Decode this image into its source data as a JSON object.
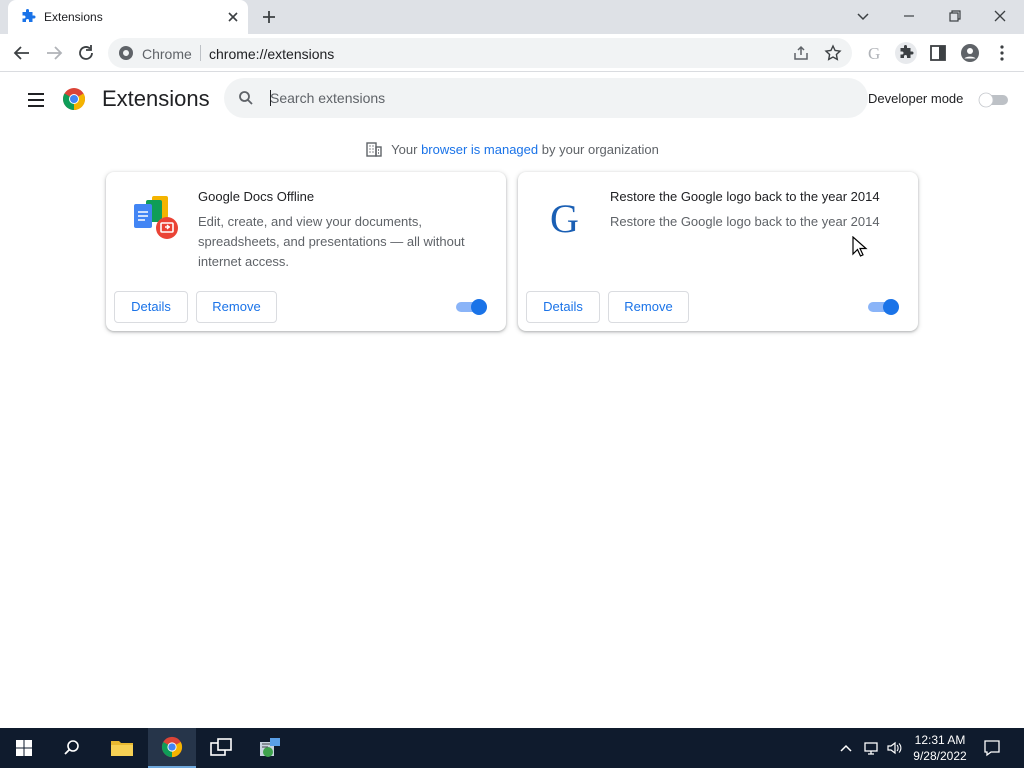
{
  "browser": {
    "tab_title": "Extensions",
    "omnibox_site": "Chrome",
    "omnibox_url": "chrome://extensions"
  },
  "header": {
    "title": "Extensions",
    "search_placeholder": "Search extensions",
    "developer_mode_label": "Developer mode",
    "developer_mode_on": false
  },
  "managed_banner": {
    "prefix": "Your",
    "link": "browser is managed",
    "suffix": "by your organization"
  },
  "extensions": [
    {
      "name": "Google Docs Offline",
      "description": "Edit, create, and view your documents, spreadsheets, and presentations — all without internet access.",
      "details_label": "Details",
      "remove_label": "Remove",
      "enabled": true,
      "icon": "google-docs-offline-icon"
    },
    {
      "name": "Restore the Google logo back to the year 2014",
      "description": "Restore the Google logo back to the year 2014",
      "details_label": "Details",
      "remove_label": "Remove",
      "enabled": true,
      "icon": "google-g-icon"
    }
  ],
  "taskbar": {
    "time": "12:31 AM",
    "date": "9/28/2022"
  },
  "colors": {
    "accent": "#1a73e8",
    "toggle_track_on": "#8ab4f8",
    "taskbar_bg": "#0f1b2d"
  }
}
